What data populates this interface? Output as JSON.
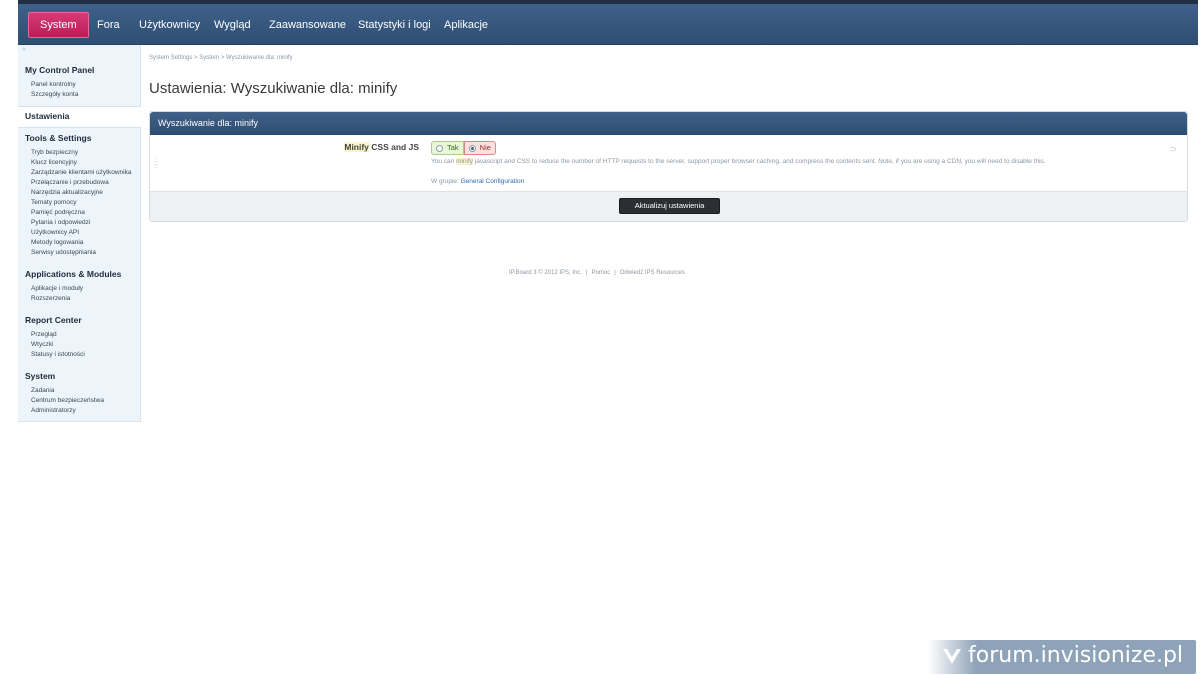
{
  "nav": {
    "items": [
      "System",
      "Fora",
      "Użytkownicy",
      "Wygląd",
      "Zaawansowane",
      "Statystyki i logi",
      "Aplikacje"
    ],
    "active": "System"
  },
  "sidebar": {
    "collapse_glyph": "«",
    "groups": [
      {
        "title": "My Control Panel",
        "links": [
          "Panel kontrolny",
          "Szczegóły konta"
        ]
      },
      {
        "title": "Ustawienia",
        "links": []
      },
      {
        "title": "Tools & Settings",
        "links": [
          "Tryb bezpieczny",
          "Klucz licencyjny",
          "Zarządzanie klientami użytkownika",
          "Przełączanie i przebudowa",
          "Narzędzia aktualizacyjne",
          "Tematy pomocy",
          "Pamięć podręczna",
          "Pytania i odpowiedzi",
          "Użytkownicy API",
          "Metody logowania",
          "Serwisy udostępniania"
        ]
      },
      {
        "title": "Applications & Modules",
        "links": [
          "Aplikacje i moduły",
          "Rozszerzenia"
        ]
      },
      {
        "title": "Report Center",
        "links": [
          "Przegląd",
          "Wtyczki",
          "Statusy i istotności"
        ]
      },
      {
        "title": "System",
        "links": [
          "Zadania",
          "Centrum bezpieczeństwa",
          "Administratorzy"
        ]
      }
    ]
  },
  "breadcrumb": "System Settings  >  System  >  Wyszukiwanie dla: minify",
  "page_title": "Ustawienia: Wyszukiwanie dla: minify",
  "panel": {
    "title": "Wyszukiwanie dla: minify",
    "setting": {
      "label_highlight": "Minify",
      "label_rest": " CSS and JS",
      "yes_label": "Tak",
      "no_label": "Nie",
      "selected": "Nie",
      "desc_pre": "You can ",
      "desc_highlight": "minify",
      "desc_post": " javascript and CSS to reduce the number of HTTP requests to the server, support proper browser caching, and compress the contents sent. Note, if you are using a CDN, you will need to disable this.",
      "group_prefix": "W grupie: ",
      "group_link": "General Configuration"
    },
    "submit_label": "Aktualizuj ustawienia"
  },
  "footer": {
    "copyright": "IP.Board 3 © 2012 IPS, Inc.",
    "help": "Pomoc",
    "visit": "Odwiedź IPS Resources",
    "separator": "|"
  },
  "watermark": {
    "text": "forum.invisionize.pl"
  },
  "colors": {
    "nav_bg": "#3a5a80",
    "active_tab": "#c8266a",
    "sidebar_bg": "#eef5fa",
    "link_blue": "#2f6bb0"
  }
}
